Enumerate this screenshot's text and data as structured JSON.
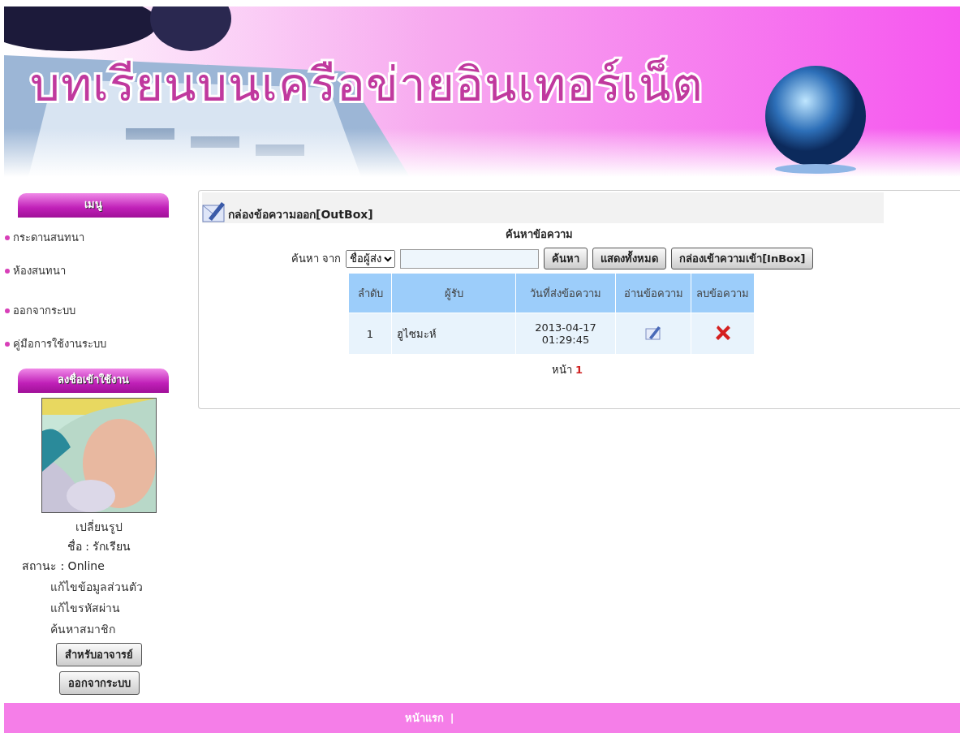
{
  "banner": {
    "title": "บทเรียนบนเครือข่ายอินเทอร์เน็ต"
  },
  "sidebar": {
    "menu_title": "เมนู",
    "menu_items": [
      {
        "label": "กระดานสนทนา"
      },
      {
        "label": "ห้องสนทนา"
      },
      {
        "label": "ออกจากระบบ"
      },
      {
        "label": "คู่มือการใช้งานระบบ"
      }
    ],
    "login_title": "ลงชื่อเข้าใช้งาน",
    "profile": {
      "photo": {
        "kind": "picture"
      },
      "change_photo": "เปลี่ยนรูป",
      "name": "ชื่อ : รักเรียน",
      "status": "สถานะ : Online",
      "links": [
        "แก้ไขข้อมูลส่วนตัว",
        "แก้ไขรหัสผ่าน",
        "ค้นหาสมาชิก"
      ],
      "buttons": [
        "สำหรับอาจารย์",
        "ออกจากระบบ"
      ]
    }
  },
  "outbox": {
    "title": "กล่องข้อความออก[OutBox]",
    "search_title": "ค้นหาข้อความ",
    "search": {
      "label": "ค้นหา จาก",
      "select_value": "ชื่อผู้ส่ง",
      "buttons": [
        "ค้นหา",
        "แสดงทั้งหมด",
        "กล่องเข้าความเข้า[InBox]"
      ]
    },
    "table": {
      "columns": [
        "ลำดับ",
        "ผู้รับ",
        "วันที่ส่งข้อความ",
        "อ่านข้อความ",
        "ลบข้อความ"
      ],
      "rows": [
        {
          "number": "1",
          "recipient": "ฮูไซมะห์",
          "sent": "2013-04-17 01:29:45"
        }
      ]
    },
    "pager": {
      "label": "หน้า",
      "pages": [
        {
          "label": "1",
          "selected": true
        }
      ]
    }
  },
  "footer": {
    "links": [
      "หน้าแรก"
    ],
    "separator": "|"
  }
}
